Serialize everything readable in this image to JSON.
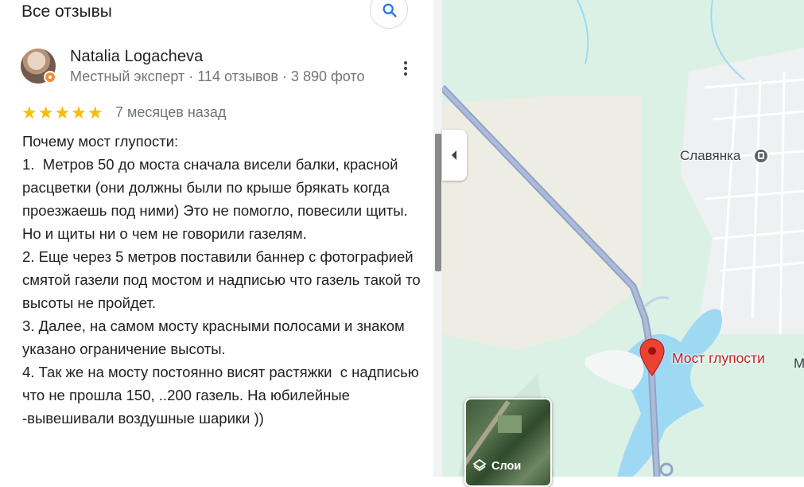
{
  "panel": {
    "title": "Все отзывы",
    "search_icon": "search-icon"
  },
  "review": {
    "author": "Natalia Logacheva",
    "meta": "Местный эксперт · 114 отзывов · 3 890 фото",
    "rating": 5,
    "stars": "★★★★★",
    "time": "7 месяцев назад",
    "text": "Почему мост глупости:\n1.  Метров 50 до моста сначала висели балки, красной расцветки (они должны были по крыше брякать когда проезжаешь под ними) Это не помогло, повесили щиты. Но и щиты ни о чем не говорили газелям.\n2. Еще через 5 метров поставили баннер с фотографией смятой газели под мостом и надписью что газель такой то высоты не пройдет.\n3. Далее, на самом мосту красными полосами и знаком указано ограничение высоты.\n4. Так же на мосту постоянно висят растяжки  с надписью что не прошла 150, ..200 газель. На юбилейные -вывешивали воздушные шарики ))"
  },
  "map": {
    "town_label": "Славянка",
    "place_label": "Мост глупости",
    "edge_label": "М",
    "layers_label": "Слои",
    "colors": {
      "land": "#dcf1e6",
      "water": "#9ed9f3",
      "road": "#8fa3c8",
      "pin": "#ea4335",
      "place_text": "#c5221f"
    }
  }
}
